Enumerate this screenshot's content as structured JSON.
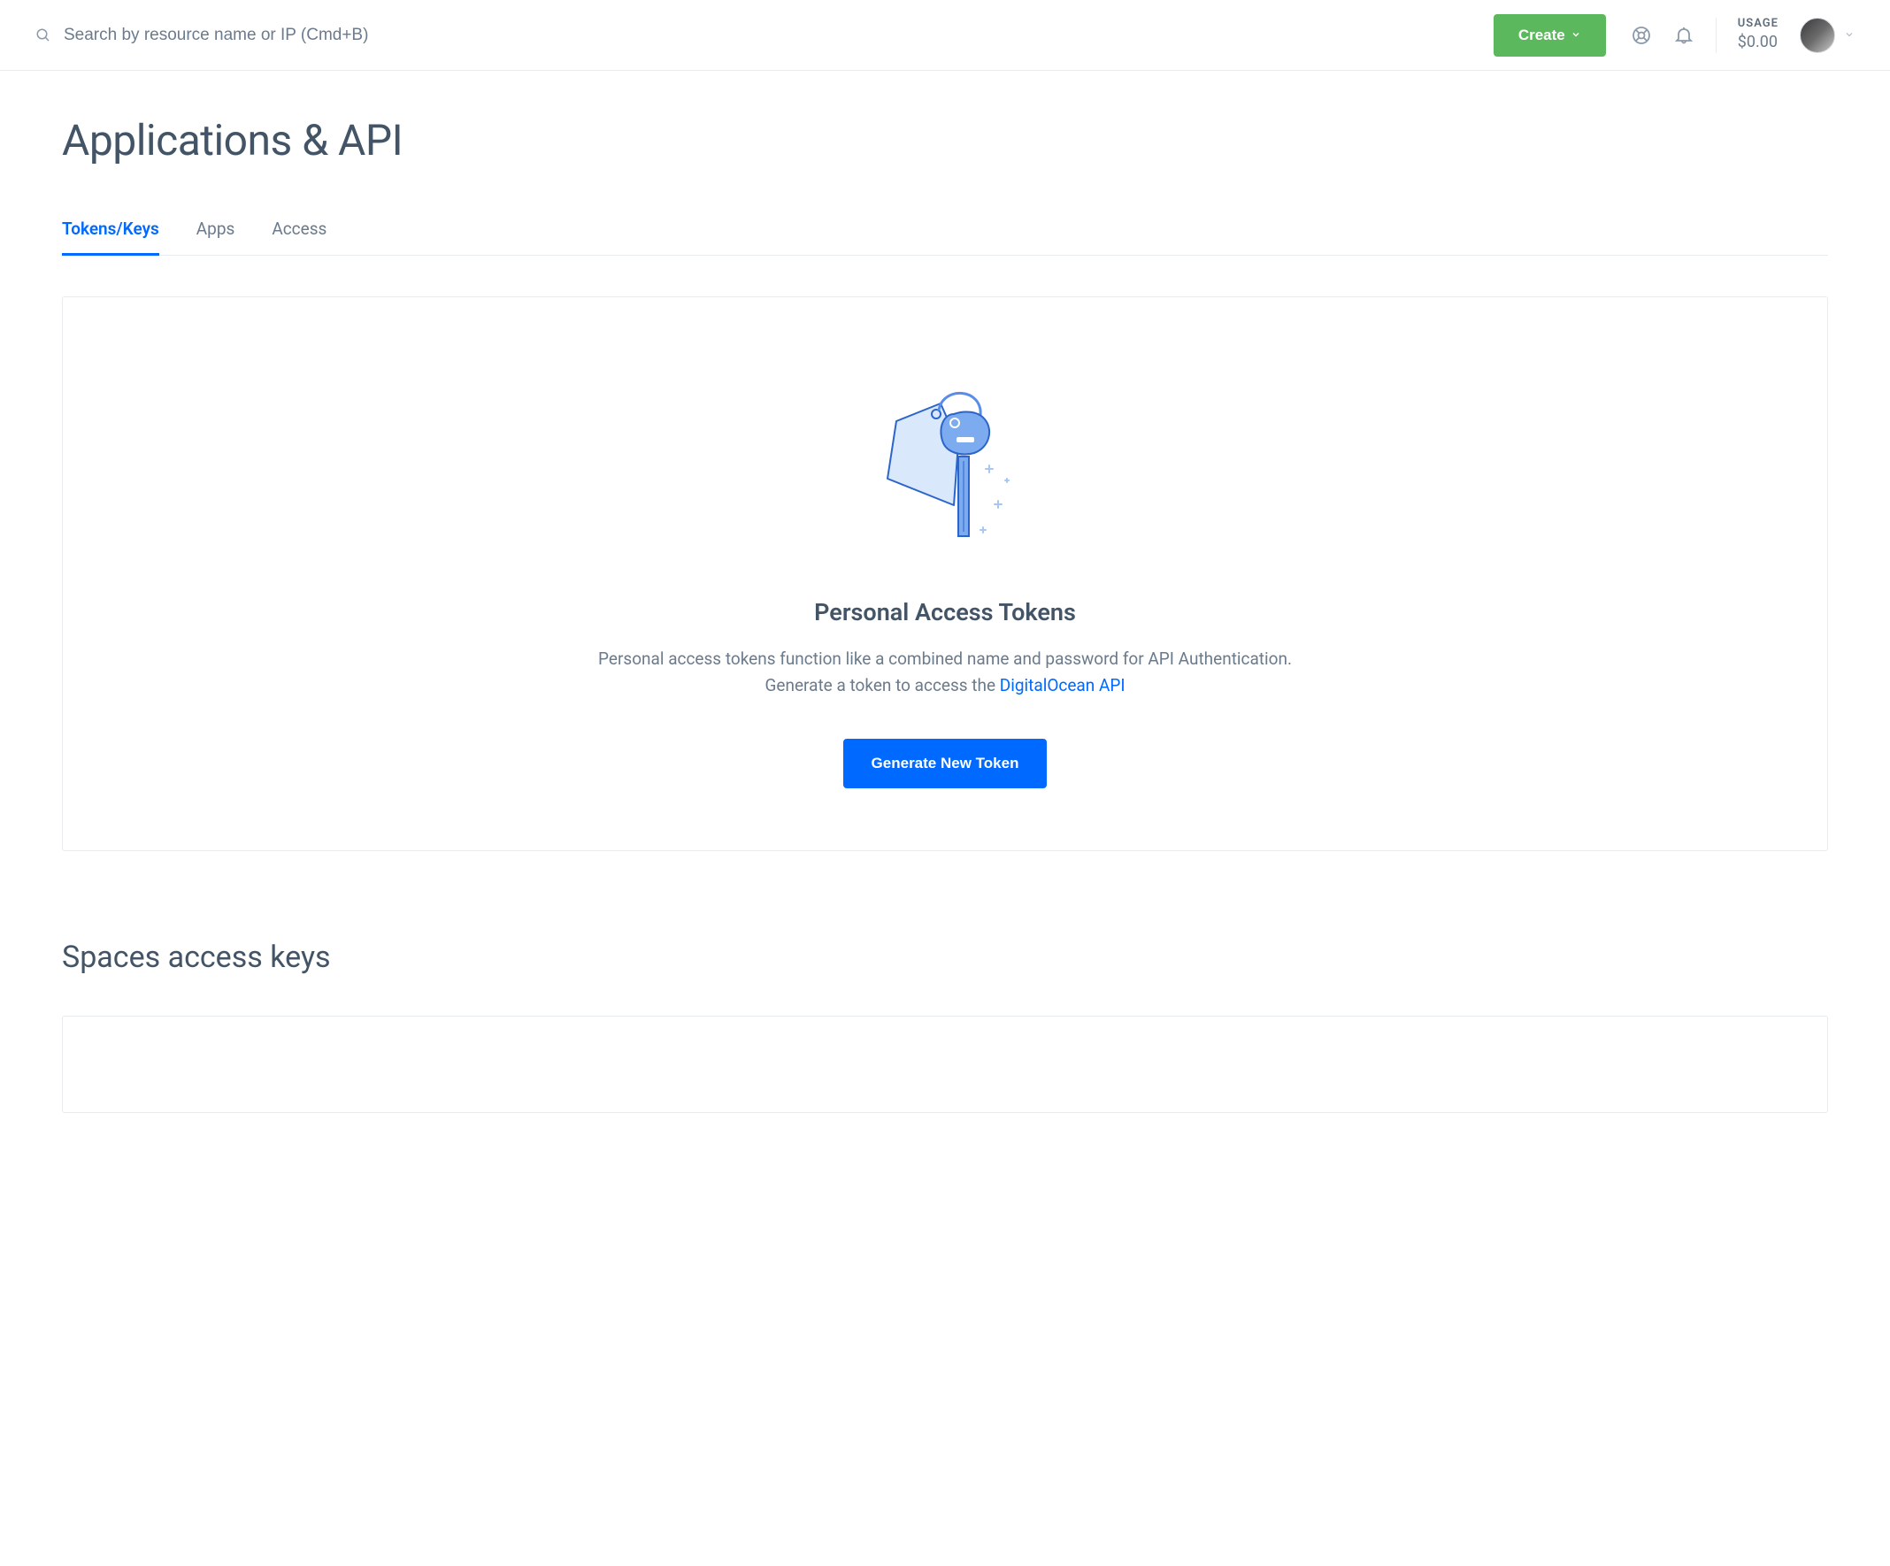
{
  "header": {
    "search_placeholder": "Search by resource name or IP (Cmd+B)",
    "create_label": "Create",
    "usage_label": "USAGE",
    "usage_amount": "$0.00"
  },
  "page": {
    "title": "Applications & API"
  },
  "tabs": [
    {
      "label": "Tokens/Keys",
      "active": true
    },
    {
      "label": "Apps",
      "active": false
    },
    {
      "label": "Access",
      "active": false
    }
  ],
  "panel": {
    "heading": "Personal Access Tokens",
    "description": "Personal access tokens function like a combined name and password for API Authentication. Generate a token to access the ",
    "link_text": "DigitalOcean API",
    "button_label": "Generate New Token"
  },
  "section": {
    "title": "Spaces access keys"
  }
}
